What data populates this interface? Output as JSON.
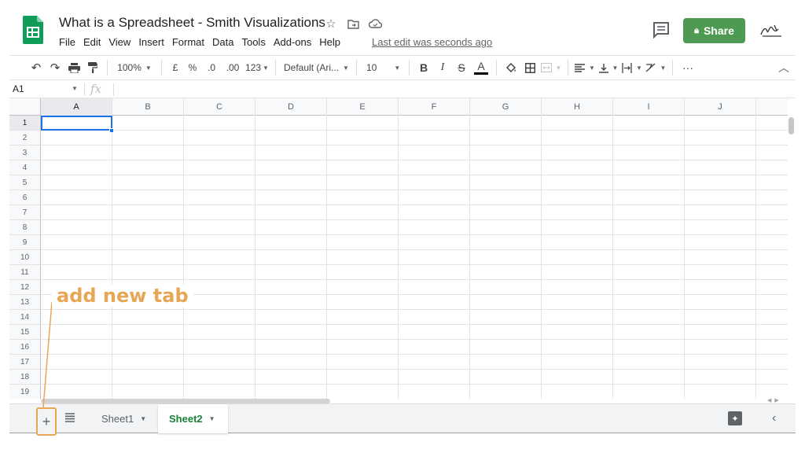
{
  "header": {
    "title": "What is a Spreadsheet - Smith Visualizations",
    "menu": [
      "File",
      "Edit",
      "View",
      "Insert",
      "Format",
      "Data",
      "Tools",
      "Add-ons",
      "Help"
    ],
    "last_edit": "Last edit was seconds ago",
    "share_label": "Share",
    "icons": [
      "star-icon",
      "move-to-folder-icon",
      "cloud-saved-icon",
      "comment-icon",
      "lock-icon"
    ]
  },
  "toolbar": {
    "zoom": "100%",
    "currency": "£",
    "percent": "%",
    "decrease_decimal": ".0",
    "increase_decimal": ".00",
    "more_formats": "123",
    "font": "Default (Ari...",
    "font_size": "10",
    "bold": "B",
    "italic": "I",
    "strikethrough": "S",
    "text_color": "A",
    "more": "···"
  },
  "formula_bar": {
    "cell_ref": "A1",
    "fx": "fx"
  },
  "grid": {
    "columns": [
      "A",
      "B",
      "C",
      "D",
      "E",
      "F",
      "G",
      "H",
      "I",
      "J"
    ],
    "rows": [
      "1",
      "2",
      "3",
      "4",
      "5",
      "6",
      "7",
      "8",
      "9",
      "10",
      "11",
      "12",
      "13",
      "14",
      "15",
      "16",
      "17",
      "18",
      "19"
    ],
    "selected_cell": "A1"
  },
  "sheets": {
    "add_label": "+",
    "tabs": [
      {
        "label": "Sheet1",
        "active": false
      },
      {
        "label": "Sheet2",
        "active": true
      }
    ]
  },
  "annotation": {
    "text": "add new tab",
    "color": "#e6a654"
  },
  "colors": {
    "brand_green": "#0f9d58",
    "share_green": "#4e9a52",
    "active_tab_text": "#188038",
    "selection_blue": "#1a73e8"
  }
}
